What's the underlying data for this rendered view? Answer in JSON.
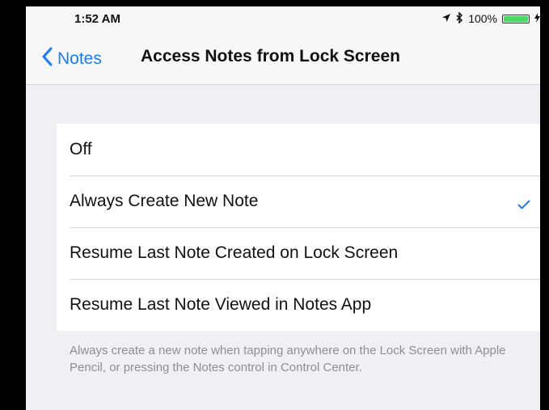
{
  "status_bar": {
    "time": "1:52 AM",
    "battery_percent": "100%",
    "battery_level": 1.0
  },
  "nav": {
    "back_label": "Notes",
    "title": "Access Notes from Lock Screen"
  },
  "options": [
    {
      "label": "Off",
      "selected": false
    },
    {
      "label": "Always Create New Note",
      "selected": true
    },
    {
      "label": "Resume Last Note Created on Lock Screen",
      "selected": false
    },
    {
      "label": "Resume Last Note Viewed in Notes App",
      "selected": false
    }
  ],
  "footer_text": "Always create a new note when tapping anywhere on the Lock Screen with Apple Pencil, or pressing the Notes control in Control Center.",
  "colors": {
    "accent": "#1a7cf5",
    "battery": "#4cd964",
    "background": "#efeff4"
  }
}
